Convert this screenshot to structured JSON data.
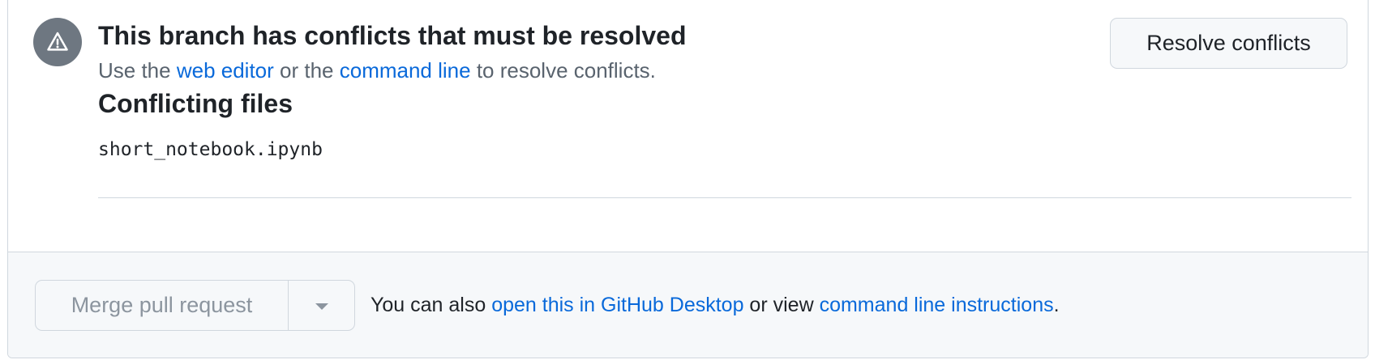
{
  "conflict": {
    "heading": "This branch has conflicts that must be resolved",
    "sub_prefix": "Use the ",
    "web_editor_link": "web editor",
    "sub_mid": " or the ",
    "command_line_link": "command line",
    "sub_suffix": " to resolve conflicts.",
    "resolve_button": "Resolve conflicts",
    "conflicting_files_title": "Conflicting files",
    "files": [
      "short_notebook.ipynb"
    ],
    "icon": "alert-icon"
  },
  "footer": {
    "merge_button": "Merge pull request",
    "dropdown_icon": "chevron-down-icon",
    "text_prefix": "You can also ",
    "desktop_link": "open this in GitHub Desktop",
    "text_mid": " or view ",
    "instructions_link": "command line instructions",
    "text_suffix": "."
  },
  "colors": {
    "link": "#0969da",
    "icon_bg": "#6e7781",
    "border": "#d0d7de",
    "footer_bg": "#f6f8fa",
    "muted_text": "#59636e",
    "disabled_text": "#8c959f"
  }
}
